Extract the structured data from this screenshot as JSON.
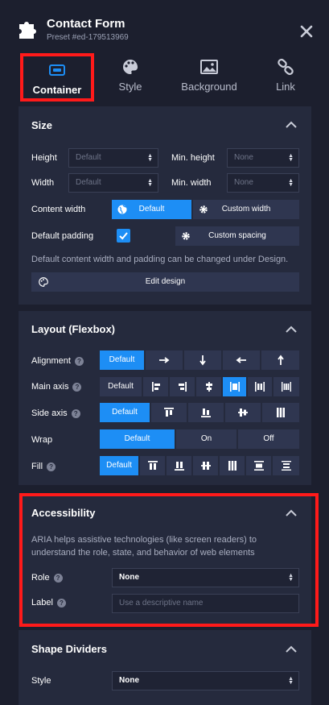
{
  "header": {
    "title": "Contact Form",
    "subtitle": "Preset #ed-179513969"
  },
  "tabs": [
    {
      "label": "Container",
      "active": true
    },
    {
      "label": "Style",
      "active": false
    },
    {
      "label": "Background",
      "active": false
    },
    {
      "label": "Link",
      "active": false
    }
  ],
  "size": {
    "title": "Size",
    "height_label": "Height",
    "height_placeholder": "Default",
    "min_height_label": "Min. height",
    "min_height_placeholder": "None",
    "width_label": "Width",
    "width_placeholder": "Default",
    "min_width_label": "Min. width",
    "min_width_placeholder": "None",
    "content_width_label": "Content width",
    "content_width_default": "Default",
    "content_width_custom": "Custom width",
    "default_padding_label": "Default padding",
    "default_padding_checked": true,
    "custom_spacing": "Custom spacing",
    "note": "Default content width and padding can be changed under Design.",
    "edit_design": "Edit design"
  },
  "layout": {
    "title": "Layout (Flexbox)",
    "alignment_label": "Alignment",
    "alignment_default": "Default",
    "main_axis_label": "Main axis",
    "main_axis_default": "Default",
    "side_axis_label": "Side axis",
    "side_axis_default": "Default",
    "wrap_label": "Wrap",
    "wrap_options": [
      "Default",
      "On",
      "Off"
    ],
    "fill_label": "Fill",
    "fill_default": "Default"
  },
  "accessibility": {
    "title": "Accessibility",
    "description_line1": "ARIA helps assistive technologies (like screen readers) to",
    "description_line2": "understand the role, state, and behavior of web elements",
    "role_label": "Role",
    "role_value": "None",
    "label_label": "Label",
    "label_placeholder": "Use a descriptive name"
  },
  "shape_dividers": {
    "title": "Shape Dividers",
    "style_label": "Style",
    "style_value": "None"
  },
  "colors": {
    "accent": "#1d8ef5",
    "highlight": "#ff1a1a",
    "panel": "#1c1f2e",
    "section": "#252a3d"
  }
}
